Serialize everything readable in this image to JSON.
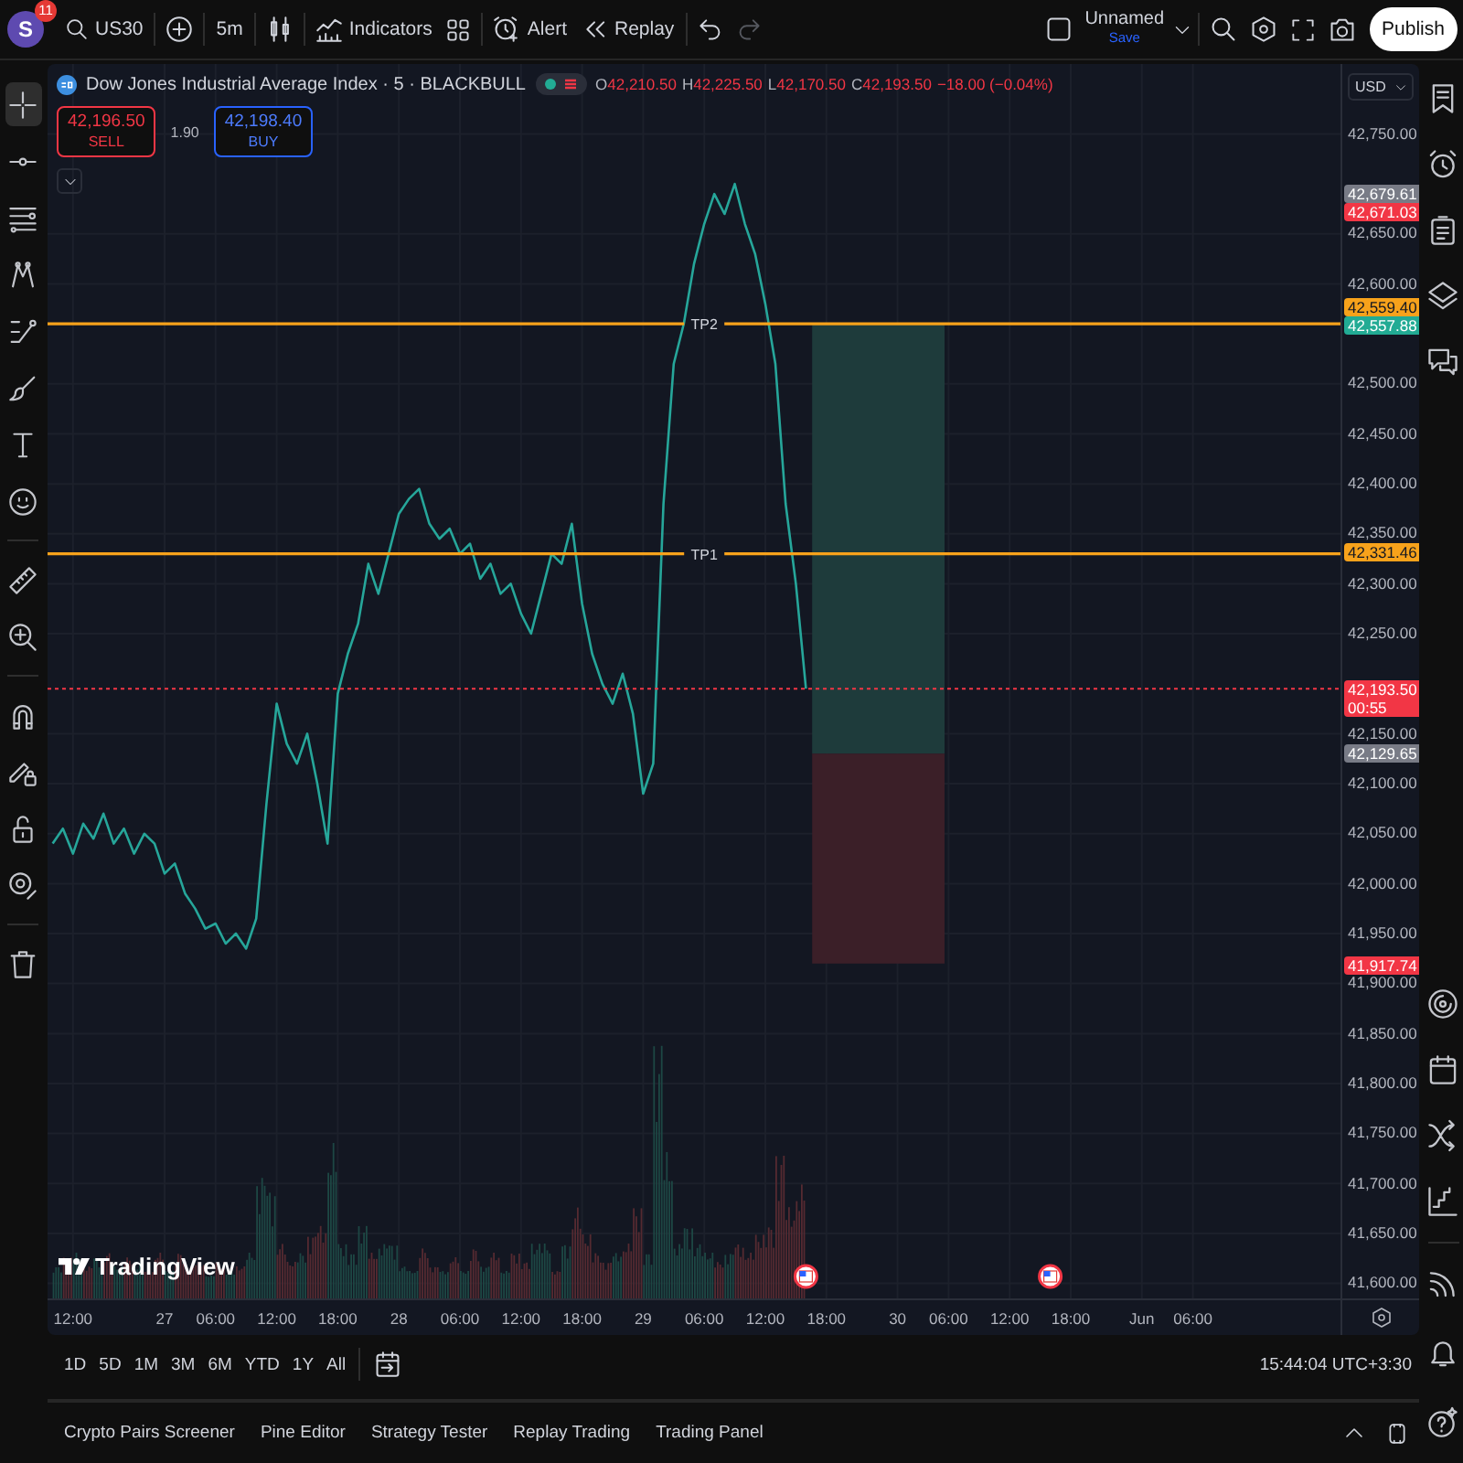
{
  "top_bar": {
    "avatar": {
      "letter": "S",
      "badge": "11"
    },
    "symbol": "US30",
    "interval": "5m",
    "buttons": [
      {
        "kind": "indicators",
        "label": "Indicators"
      },
      {
        "kind": "alert",
        "label": "Alert"
      },
      {
        "kind": "replay",
        "label": "Replay"
      }
    ],
    "undo": {
      "disabled": false
    },
    "redo": {
      "disabled": true
    },
    "layout": {
      "name": "Unnamed",
      "status": "Save"
    },
    "publish": "Publish"
  },
  "left_toolbar": {
    "groups": [
      {
        "tools": [
          {
            "kind": "crosshair",
            "selected": true
          },
          {
            "kind": "trendline",
            "selected": false
          },
          {
            "kind": "fibonacci",
            "selected": false
          },
          {
            "kind": "patterns",
            "selected": false
          },
          {
            "kind": "prediction",
            "selected": false
          },
          {
            "kind": "brush",
            "selected": false
          },
          {
            "kind": "text",
            "selected": false
          },
          {
            "kind": "emoji",
            "selected": false
          }
        ]
      },
      {
        "tools": [
          {
            "kind": "ruler",
            "selected": false
          },
          {
            "kind": "zoom",
            "selected": false
          }
        ]
      },
      {
        "tools": [
          {
            "kind": "magnet",
            "selected": false
          },
          {
            "kind": "staylock",
            "selected": false
          },
          {
            "kind": "lock",
            "selected": false
          },
          {
            "kind": "visibility",
            "selected": false
          }
        ]
      },
      {
        "tools": [
          {
            "kind": "trash",
            "selected": false
          }
        ]
      }
    ]
  },
  "chart": {
    "legend": {
      "title": "Dow Jones Industrial Average Index · 5 · BLACKBULL",
      "ohlc": [
        {
          "key": "O",
          "value": "42,210.50"
        },
        {
          "key": "H",
          "value": "42,225.50"
        },
        {
          "key": "L",
          "value": "42,170.50"
        },
        {
          "key": "C",
          "value": "42,193.50"
        }
      ],
      "change": "−18.00 (−0.04%)",
      "down": true
    },
    "trade": {
      "sell": {
        "price": "42,196.50",
        "label": "SELL"
      },
      "spread": "1.90",
      "buy": {
        "price": "42,198.40",
        "label": "BUY"
      }
    },
    "currency": "USD",
    "logo": "TradingView",
    "price_badges": [
      {
        "text": "42,679.61",
        "color": "#787b86"
      },
      {
        "text": "42,671.03",
        "color": "#f23645"
      },
      {
        "text": "42,559.40",
        "color": "#f7a21b"
      },
      {
        "text": "42,557.88",
        "color": "#22ab94"
      },
      {
        "text": "42,331.46",
        "color": "#f7a21b"
      },
      {
        "text": "42,193.50",
        "countdown": "00:55",
        "color": "#f23645"
      },
      {
        "text": "42,129.65",
        "color": "#787b86"
      },
      {
        "text": "41,917.74",
        "color": "#f23645"
      }
    ],
    "chart_data": {
      "type": "line",
      "grid": true,
      "categories": [
        null,
        null,
        "12:00",
        null,
        null,
        null,
        null,
        null,
        null,
        null,
        null,
        "27",
        null,
        null,
        null,
        null,
        "06:00",
        null,
        null,
        null,
        null,
        null,
        "12:00",
        null,
        null,
        null,
        null,
        null,
        "18:00",
        null,
        null,
        null,
        null,
        null,
        "28",
        null,
        null,
        null,
        null,
        null,
        "06:00",
        null,
        null,
        null,
        null,
        null,
        "12:00",
        null,
        null,
        null,
        null,
        null,
        "18:00",
        null,
        null,
        null,
        null,
        null,
        "29",
        null,
        null,
        null,
        null,
        null,
        "06:00",
        null,
        null,
        null,
        null,
        null,
        "12:00",
        null,
        null,
        null,
        null,
        null,
        "18:00",
        null,
        null,
        null,
        null,
        null,
        null,
        "30",
        null,
        null,
        null,
        null,
        "06:00",
        null,
        null,
        null,
        null,
        null,
        "12:00",
        null,
        null,
        null,
        null,
        null,
        "18:00",
        null,
        null,
        null,
        null,
        null,
        null,
        "Jun",
        null,
        null,
        null,
        null,
        "06:00",
        null,
        null,
        null,
        null,
        null,
        null,
        null,
        null,
        null,
        null,
        null,
        null,
        null,
        null
      ],
      "series": [
        {
          "color": "#26a69a",
          "values": [
            42040,
            42055,
            42030,
            42060,
            42045,
            42070,
            42040,
            42055,
            42030,
            42050,
            42040,
            42010,
            42020,
            41990,
            41975,
            41955,
            41960,
            41940,
            41950,
            41935,
            41965,
            42080,
            42180,
            42140,
            42120,
            42150,
            42100,
            42040,
            42190,
            42230,
            42260,
            42320,
            42290,
            42330,
            42370,
            42385,
            42395,
            42360,
            42345,
            42355,
            42330,
            42340,
            42305,
            42320,
            42290,
            42300,
            42270,
            42250,
            42290,
            42330,
            42320,
            42360,
            42280,
            42230,
            42200,
            42180,
            42210,
            42170,
            42090,
            42120,
            42380,
            42520,
            42560,
            42620,
            42660,
            42690,
            42670,
            42700,
            42660,
            42630,
            42580,
            42520,
            42380,
            42300,
            42195,
            null,
            null,
            null,
            null,
            null,
            null,
            null,
            null,
            null,
            null,
            null,
            null,
            null,
            null,
            null,
            null,
            null,
            null,
            null,
            null,
            null,
            null,
            null,
            null,
            null,
            null,
            null,
            null,
            null,
            null,
            null,
            null,
            null,
            null,
            null,
            null,
            null,
            null,
            null,
            null,
            null,
            null,
            null,
            null,
            null,
            null,
            null,
            null,
            null,
            null,
            null,
            null
          ]
        }
      ],
      "ylim": [
        41585,
        42820
      ],
      "yticks": [
        {
          "value": 42750,
          "label": "42,750.00"
        },
        {
          "value": 42650,
          "label": "42,650.00"
        },
        {
          "value": 42600,
          "label": "42,600.00"
        },
        {
          "value": 42500,
          "label": "42,500.00"
        },
        {
          "value": 42450,
          "label": "42,450.00"
        },
        {
          "value": 42400,
          "label": "42,400.00"
        },
        {
          "value": 42350,
          "label": "42,350.00"
        },
        {
          "value": 42300,
          "label": "42,300.00"
        },
        {
          "value": 42250,
          "label": "42,250.00"
        },
        {
          "value": 42150,
          "label": "42,150.00"
        },
        {
          "value": 42100,
          "label": "42,100.00"
        },
        {
          "value": 42050,
          "label": "42,050.00"
        },
        {
          "value": 42000,
          "label": "42,000.00"
        },
        {
          "value": 41950,
          "label": "41,950.00"
        },
        {
          "value": 41900,
          "label": "41,900.00"
        },
        {
          "value": 41850,
          "label": "41,850.00"
        },
        {
          "value": 41800,
          "label": "41,800.00"
        },
        {
          "value": 41750,
          "label": "41,750.00"
        },
        {
          "value": 41700,
          "label": "41,700.00"
        },
        {
          "value": 41650,
          "label": "41,650.00"
        },
        {
          "value": 41600,
          "label": "41,600.00"
        }
      ],
      "bands": [
        {
          "axis": "y",
          "from": 42130,
          "to": 42560,
          "color": "#1e3b3b"
        },
        {
          "axis": "y",
          "from": 41920,
          "to": 42130,
          "color": "#3b1f28"
        }
      ],
      "ref_lines": [
        {
          "axis": "y",
          "value": 42560,
          "label": "TP2",
          "color": "#f7a21b"
        },
        {
          "axis": "y",
          "value": 42330,
          "label": "TP1",
          "color": "#f7a21b"
        },
        {
          "axis": "y",
          "value": 42195,
          "color": "#f23645"
        }
      ]
    }
  },
  "range_bar": {
    "ranges": [
      {
        "label": "1D",
        "selected": false
      },
      {
        "label": "5D",
        "selected": false
      },
      {
        "label": "1M",
        "selected": false
      },
      {
        "label": "3M",
        "selected": false
      },
      {
        "label": "6M",
        "selected": false
      },
      {
        "label": "YTD",
        "selected": false
      },
      {
        "label": "1Y",
        "selected": false
      },
      {
        "label": "All",
        "selected": false
      }
    ],
    "clock": "15:44:04 UTC+3:30"
  },
  "bottom_panel": {
    "tabs": [
      {
        "label": "Crypto Pairs Screener",
        "selected": false
      },
      {
        "label": "Pine Editor",
        "selected": false
      },
      {
        "label": "Strategy Tester",
        "selected": false
      },
      {
        "label": "Replay Trading",
        "selected": false
      },
      {
        "label": "Trading Panel",
        "selected": false
      }
    ]
  }
}
